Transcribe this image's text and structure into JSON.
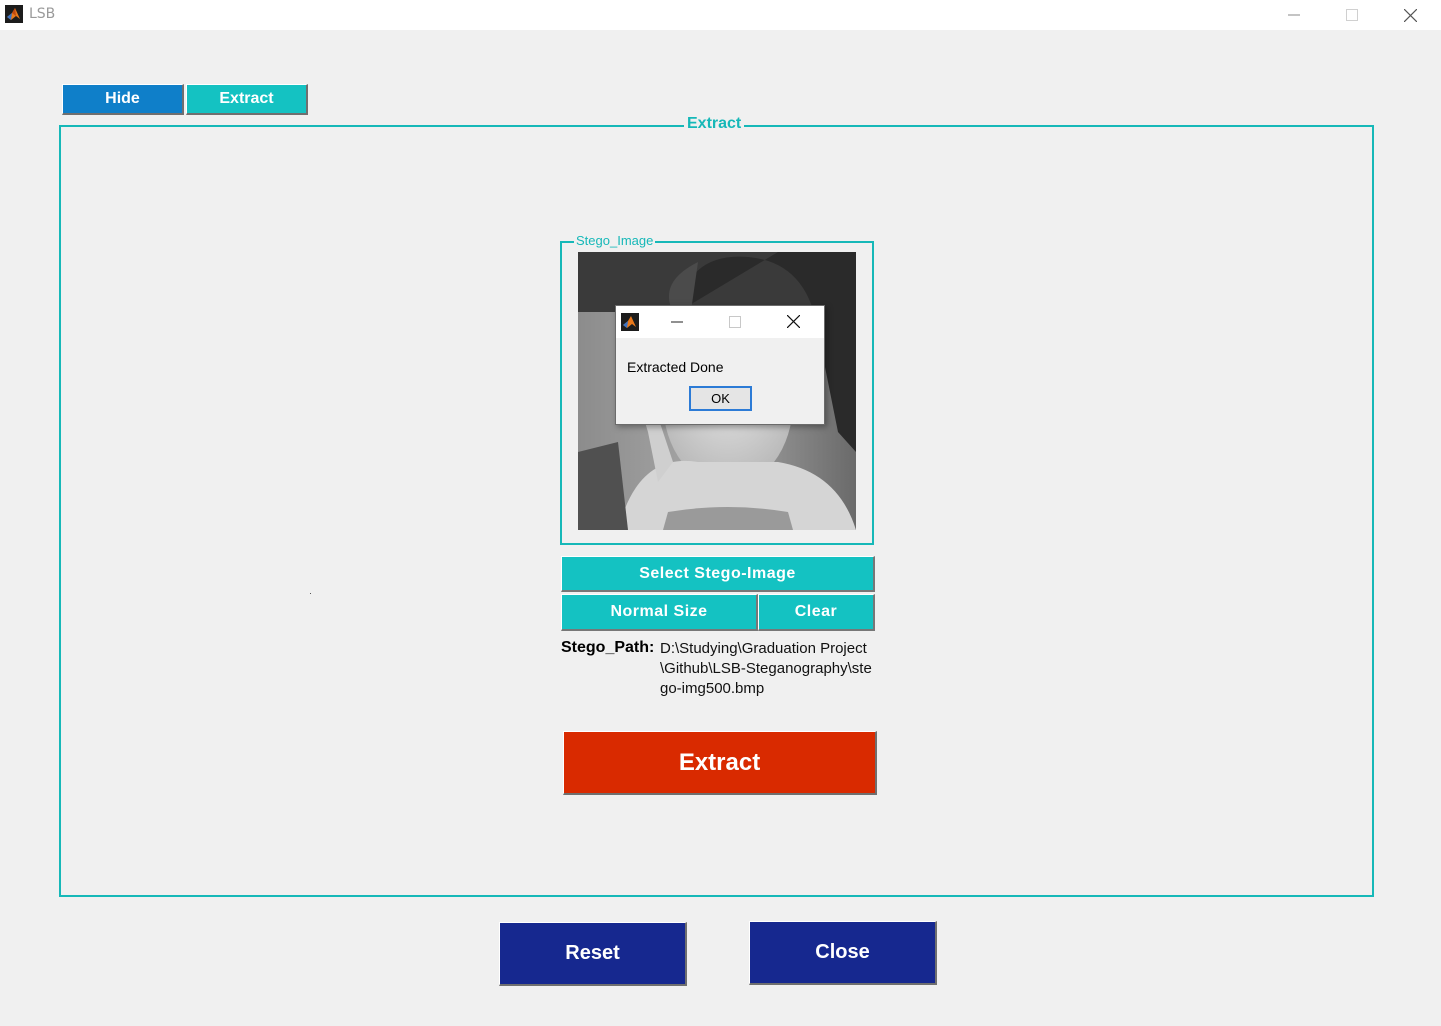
{
  "window": {
    "title": "LSB",
    "icon": "matlab-icon"
  },
  "tabs": [
    {
      "label": "Hide",
      "color": "#0f7fc9"
    },
    {
      "label": "Extract",
      "color": "#14c2c2"
    }
  ],
  "panel": {
    "title": "Extract"
  },
  "stego_panel": {
    "title": "Stego_Image"
  },
  "buttons": {
    "select_stego": "Select Stego-Image",
    "normal_size": "Normal Size",
    "clear": "Clear",
    "extract": "Extract",
    "reset": "Reset",
    "close": "Close"
  },
  "stego_path": {
    "label": "Stego_Path:",
    "value": "D:\\Studying\\Graduation Project\\Github\\LSB-Steganography\\stego-img500.bmp"
  },
  "dialog": {
    "message": "Extracted Done",
    "ok_label": "OK"
  },
  "colors": {
    "accent_teal": "#14c2c2",
    "extract_red": "#d92a00",
    "navy": "#16288f"
  }
}
